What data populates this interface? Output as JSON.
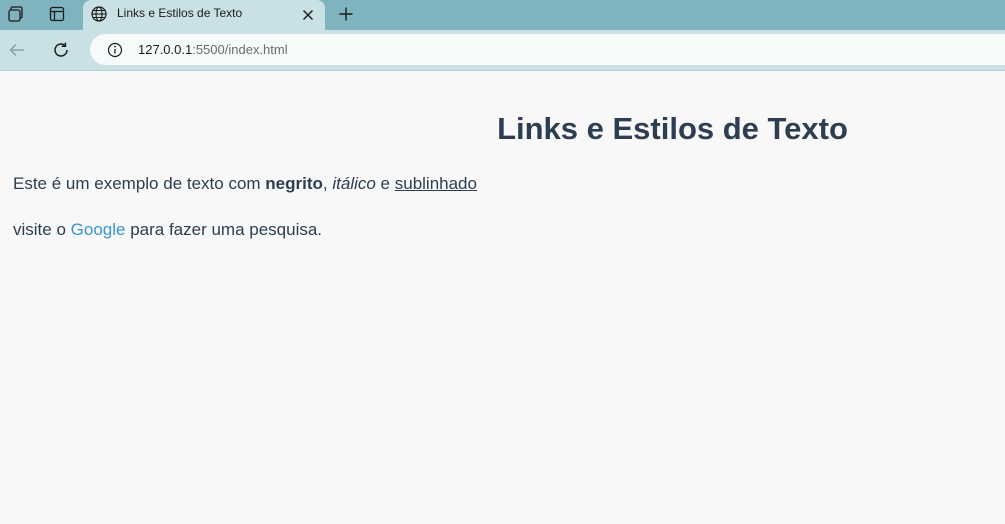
{
  "browser": {
    "tab_title": "Links e Estilos de Texto",
    "url_host": "127.0.0.1",
    "url_rest": ":5500/index.html"
  },
  "page": {
    "title": "Links e Estilos de Texto",
    "paragraph1": {
      "prefix": "Este é um exemplo de texto com ",
      "bold": "negrito",
      "sep1": ", ",
      "italic": "itálico",
      "sep2": " e ",
      "underline": "sublinhado"
    },
    "paragraph2": {
      "prefix": "visite o ",
      "link": "Google",
      "suffix": " para fazer uma pesquisa."
    }
  },
  "colors": {
    "tabbar": "#7fb4bf",
    "toolbar": "#c9e0e4",
    "page_background": "#f8f8f8",
    "text": "#2c3e50",
    "link": "#3a95d0"
  },
  "icons": {
    "workspaces": "workspaces-icon",
    "tab_actions": "tab-actions-icon",
    "favicon": "globe-icon",
    "close": "close-icon",
    "new_tab": "plus-icon",
    "back": "back-arrow-icon",
    "reload": "reload-icon",
    "site_info": "info-icon"
  }
}
